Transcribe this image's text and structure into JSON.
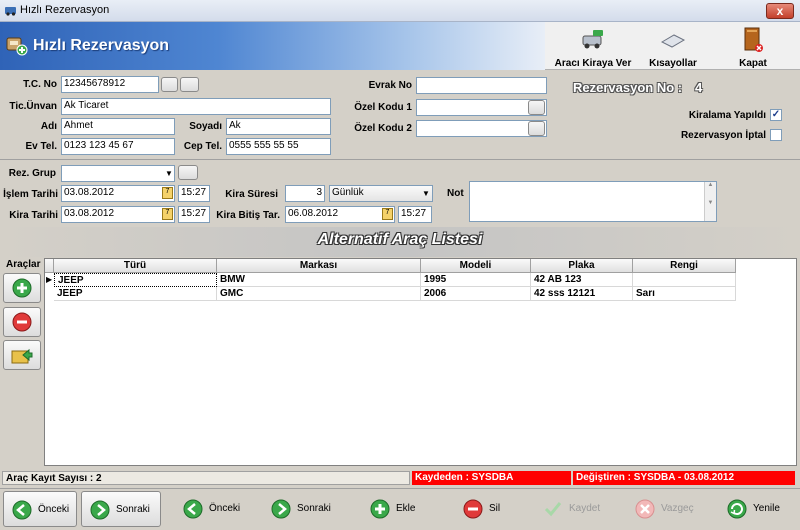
{
  "window": {
    "title": "Hızlı Rezervasyon",
    "close_label": "x"
  },
  "header": {
    "title": "Hızlı Rezervasyon",
    "toolbar": [
      {
        "label": "Aracı Kiraya Ver",
        "icon": "car-key-icon"
      },
      {
        "label": "Kısayollar",
        "icon": "keyboard-icon"
      },
      {
        "label": "Kapat",
        "icon": "book-close-icon"
      }
    ]
  },
  "form": {
    "tc_label": "T.C. No",
    "tc_value": "12345678912",
    "unvan_label": "Tic.Ünvan",
    "unvan_value": "Ak Ticaret",
    "adi_label": "Adı",
    "adi_value": "Ahmet",
    "soyadi_label": "Soyadı",
    "soyadi_value": "Ak",
    "evtel_label": "Ev Tel.",
    "evtel_value": "0123 123 45 67",
    "ceptel_label": "Cep Tel.",
    "ceptel_value": "0555 555 55 55",
    "evrak_label": "Evrak No",
    "evrak_value": "",
    "ozel1_label": "Özel Kodu 1",
    "ozel1_value": "",
    "ozel2_label": "Özel Kodu 2",
    "ozel2_value": "",
    "rez_no_label": "Rezervasyon No :",
    "rez_no_value": "4",
    "kiralama_label": "Kiralama Yapıldı",
    "kiralama_checked": true,
    "iptal_label": "Rezervasyon İptal",
    "iptal_checked": false,
    "rezgrup_label": "Rez. Grup",
    "rezgrup_value": "",
    "islem_label": "İşlem Tarihi",
    "islem_date": "03.08.2012",
    "islem_time": "15:27",
    "kira_label": "Kira Tarihi",
    "kira_date": "03.08.2012",
    "kira_time": "15:27",
    "sure_label": "Kira Süresi",
    "sure_value": "3",
    "sure_unit": "Günlük",
    "bitis_label": "Kira Bitiş Tar.",
    "bitis_date": "06.08.2012",
    "bitis_time": "15:27",
    "not_label": "Not",
    "not_value": ""
  },
  "grid": {
    "title": "Alternatif Araç Listesi",
    "side_label": "Araçlar",
    "columns": [
      "Türü",
      "Markası",
      "Modeli",
      "Plaka",
      "Rengi"
    ],
    "rows": [
      [
        "JEEP",
        "BMW",
        "1995",
        "42 AB 123",
        ""
      ],
      [
        "JEEP",
        "GMC",
        "2006",
        "42 sss 12121",
        "Sarı"
      ]
    ]
  },
  "status": {
    "count": "Araç Kayıt Sayısı : 2",
    "created_by": "Kaydeden : SYSDBA",
    "modified_by": "Değiştiren : SYSDBA - 03.08.2012"
  },
  "nav": {
    "onceki1": "Önceki",
    "sonraki1": "Sonraki",
    "onceki2": "Önceki",
    "sonraki2": "Sonraki",
    "ekle": "Ekle",
    "sil": "Sil",
    "kaydet": "Kaydet",
    "vazgec": "Vazgeç",
    "yenile": "Yenile"
  },
  "colors": {
    "status_red": "#ff0000",
    "header_blue": "#2f63b7",
    "accent_green": "#3aa84a"
  }
}
